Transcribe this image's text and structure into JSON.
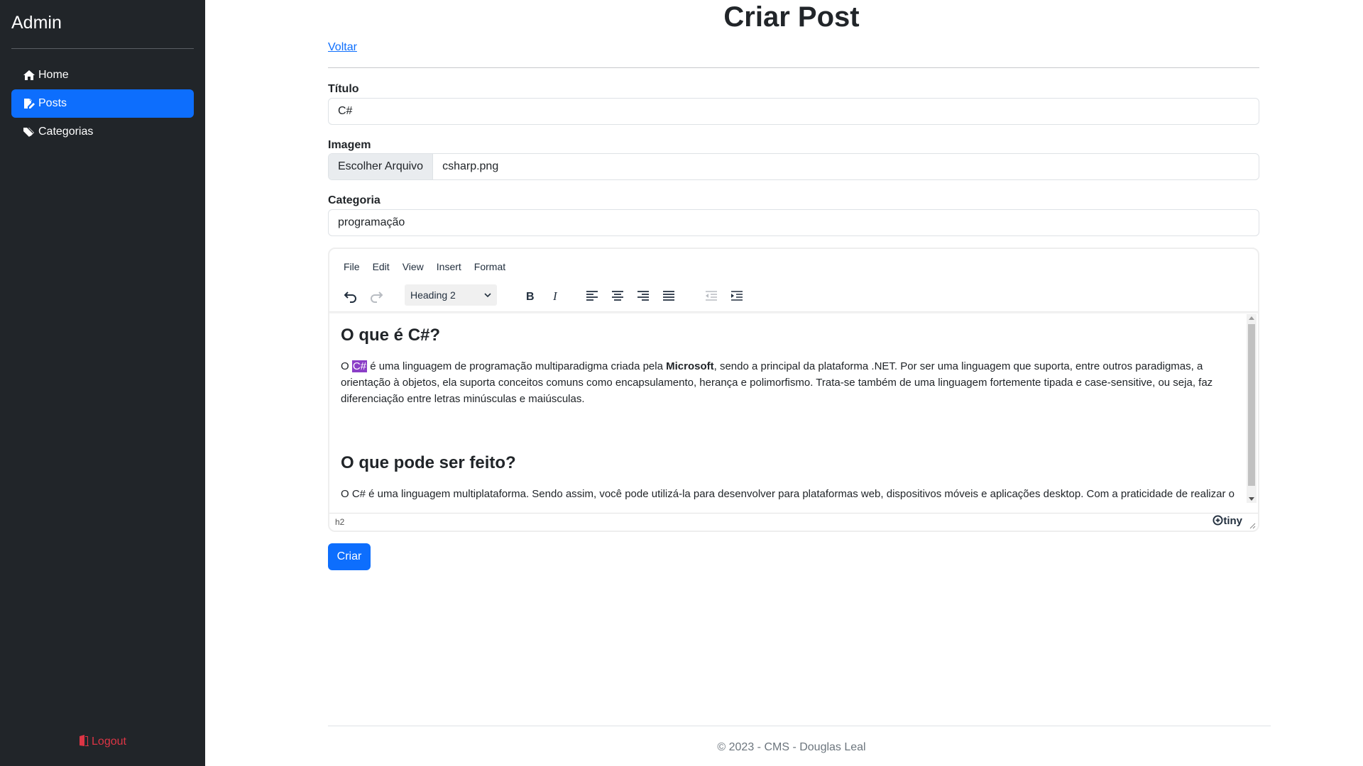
{
  "sidebar": {
    "brand": "Admin",
    "items": [
      {
        "label": "Home",
        "icon": "home-icon",
        "active": false
      },
      {
        "label": "Posts",
        "icon": "file-edit-icon",
        "active": true
      },
      {
        "label": "Categorias",
        "icon": "tags-icon",
        "active": false
      }
    ],
    "logout_label": "Logout"
  },
  "page": {
    "title": "Criar Post",
    "back_label": "Voltar"
  },
  "form": {
    "title_label": "Título",
    "title_value": "C#",
    "image_label": "Imagem",
    "file_button_label": "Escolher Arquivo",
    "file_name": "csharp.png",
    "category_label": "Categoria",
    "category_value": "programação",
    "submit_label": "Criar"
  },
  "editor": {
    "menu": [
      "File",
      "Edit",
      "View",
      "Insert",
      "Format"
    ],
    "block_format": "Heading 2",
    "content": {
      "h1": "O que é C#?",
      "p1_start": "O ",
      "p1_highlight": "C#",
      "p1_mid": " é uma linguagem de programação multiparadigma criada pela ",
      "p1_bold": "Microsoft",
      "p1_end": ", sendo a principal da plataforma .NET. Por ser uma linguagem que suporta, entre outros paradigmas, a orientação à objetos, ela suporta conceitos comuns como encapsulamento, herança e polimorfismo. Trata-se também de uma linguagem fortemente tipada e case-sensitive, ou seja, faz diferenciação entre letras minúsculas e maiúsculas.",
      "h2": "O que pode ser feito?",
      "p2": "O C# é uma linguagem multiplataforma. Sendo assim, você pode utilizá-la para desenvolver para plataformas web, dispositivos móveis e aplicações desktop. Com a praticidade de realizar o mesmo código de forma relativamente fácil de manter, desde projetos de nível até projetos e recursos multiplataforma."
    },
    "status_path": "h2",
    "branding": "tiny"
  },
  "footer": {
    "text": "© 2023 - CMS - Douglas Leal"
  },
  "colors": {
    "sidebar_bg": "#212529",
    "primary": "#0d6efd",
    "danger": "#dc3545",
    "highlight": "#8b3ec7"
  }
}
